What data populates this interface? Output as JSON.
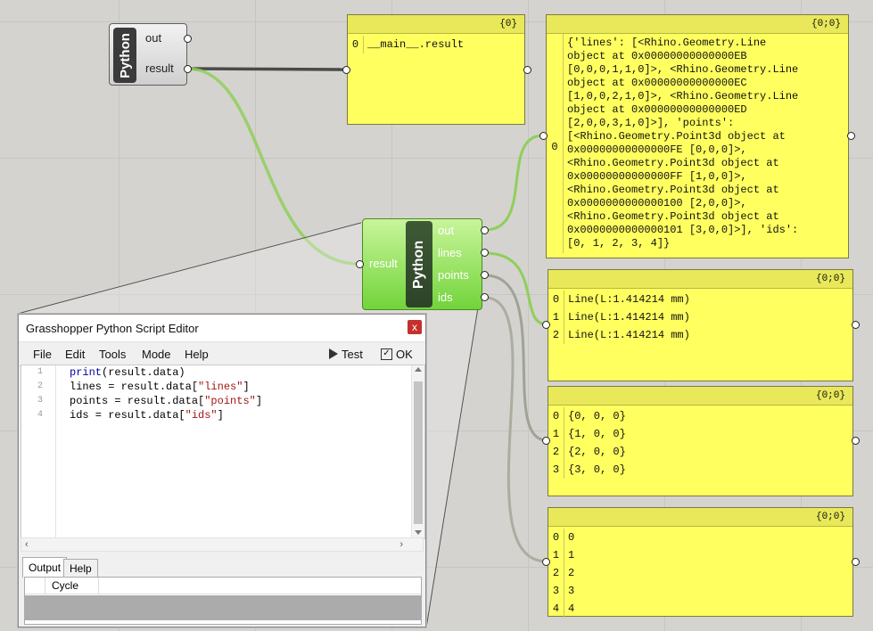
{
  "python_a": {
    "label": "Python",
    "outputs": [
      "out",
      "result"
    ]
  },
  "python_b": {
    "label": "Python",
    "input": "result",
    "outputs": [
      "out",
      "lines",
      "points",
      "ids"
    ]
  },
  "panel_main": {
    "header": "{0}",
    "rows": [
      {
        "idx": "0",
        "val": "__main__.result"
      }
    ]
  },
  "panel_dict": {
    "header": "{0;0}",
    "idx": "0",
    "text": "{'lines': [<Rhino.Geometry.Line\nobject at 0x00000000000000EB\n[0,0,0,1,1,0]>, <Rhino.Geometry.Line\nobject at 0x00000000000000EC\n[1,0,0,2,1,0]>, <Rhino.Geometry.Line\nobject at 0x00000000000000ED\n[2,0,0,3,1,0]>], 'points':\n[<Rhino.Geometry.Point3d object at\n0x00000000000000FE [0,0,0]>,\n<Rhino.Geometry.Point3d object at\n0x00000000000000FF [1,0,0]>,\n<Rhino.Geometry.Point3d object at\n0x0000000000000100 [2,0,0]>,\n<Rhino.Geometry.Point3d object at\n0x0000000000000101 [3,0,0]>], 'ids':\n[0, 1, 2, 3, 4]}"
  },
  "panel_lines": {
    "header": "{0;0}",
    "rows": [
      {
        "idx": "0",
        "val": "Line(L:1.414214 mm)"
      },
      {
        "idx": "1",
        "val": "Line(L:1.414214 mm)"
      },
      {
        "idx": "2",
        "val": "Line(L:1.414214 mm)"
      }
    ]
  },
  "panel_points": {
    "header": "{0;0}",
    "rows": [
      {
        "idx": "0",
        "val": "{0, 0, 0}"
      },
      {
        "idx": "1",
        "val": "{1, 0, 0}"
      },
      {
        "idx": "2",
        "val": "{2, 0, 0}"
      },
      {
        "idx": "3",
        "val": "{3, 0, 0}"
      }
    ]
  },
  "panel_ids": {
    "header": "{0;0}",
    "rows": [
      {
        "idx": "0",
        "val": "0"
      },
      {
        "idx": "1",
        "val": "1"
      },
      {
        "idx": "2",
        "val": "2"
      },
      {
        "idx": "3",
        "val": "3"
      },
      {
        "idx": "4",
        "val": "4"
      }
    ]
  },
  "editor": {
    "title": "Grasshopper Python Script Editor",
    "close": "x",
    "menu": [
      "File",
      "Edit",
      "Tools",
      "Mode",
      "Help"
    ],
    "test_label": "Test",
    "ok_label": "OK",
    "line_numbers": [
      "1",
      "2",
      "3",
      "4"
    ],
    "code": [
      {
        "pre": "",
        "kw": "print",
        "post": "(result.data)",
        "str": "",
        "end": ""
      },
      {
        "pre": "lines = result.data[",
        "kw": "",
        "post": "",
        "str": "\"lines\"",
        "end": "]"
      },
      {
        "pre": "points = result.data[",
        "kw": "",
        "post": "",
        "str": "\"points\"",
        "end": "]"
      },
      {
        "pre": "ids = result.data[",
        "kw": "",
        "post": "",
        "str": "\"ids\"",
        "end": "]"
      }
    ],
    "tabs": [
      "Output",
      "Help"
    ],
    "output_col": "Cycle"
  }
}
